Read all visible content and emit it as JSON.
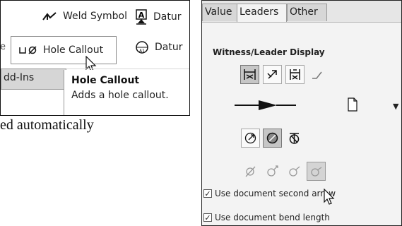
{
  "ribbon": {
    "weld_symbol": "Weld Symbol",
    "datum_top": "Datur",
    "hole_callout": "Hole Callout",
    "datum_bottom": "Datur",
    "edge_char": "e",
    "addins_tab": "dd-Ins"
  },
  "tooltip": {
    "title": "Hole Callout",
    "description": "Adds a hole callout."
  },
  "body_text": "ed automatically",
  "property_manager": {
    "tabs": [
      "Value",
      "Leaders",
      "Other"
    ],
    "active_tab": "Leaders",
    "section_title": "Witness/Leader Display",
    "checkboxes": [
      {
        "label": "Use document second arrow",
        "checked": true
      },
      {
        "label": "Use document bend length",
        "checked": true
      }
    ]
  },
  "colors": {
    "selected_button": "#c6c6c6",
    "panel_background": "#f3f3f3",
    "tab_background": "#d7d7d7"
  },
  "icons": [
    "weld-symbol-icon",
    "datum-feature-icon",
    "hole-callout-icon",
    "datum-target-icon",
    "mouse-cursor-icon",
    "witness-lines-icon",
    "leader-icon",
    "extension-lines-icon",
    "bent-leader-icon",
    "arrow-style-icon",
    "document-icon",
    "dropdown-arrow-icon",
    "outside-arrows-icon",
    "inside-arrows-icon",
    "smart-arrows-icon",
    "radial-leader-icon-1",
    "radial-leader-icon-2",
    "radial-leader-icon-3",
    "radial-leader-icon-4"
  ]
}
